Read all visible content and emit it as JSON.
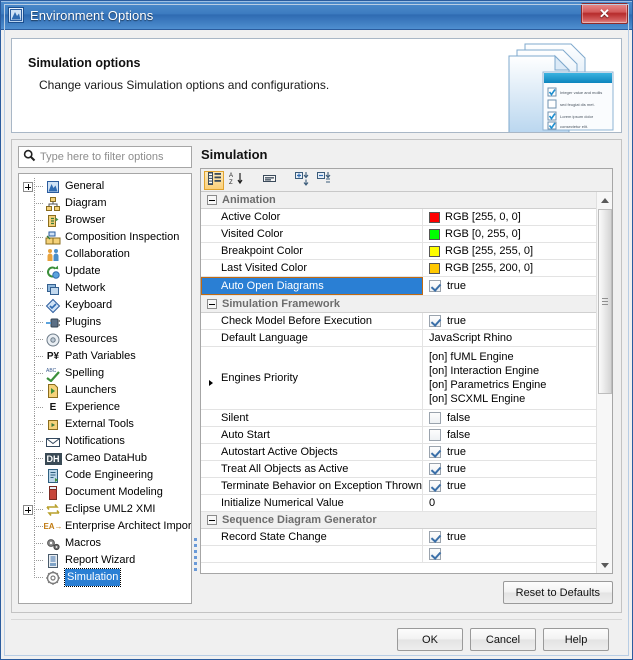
{
  "window": {
    "title": "Environment Options",
    "title_icon": "app-icon",
    "close_label": "✕"
  },
  "banner": {
    "title": "Simulation options",
    "subtitle": "Change various Simulation options and configurations.",
    "art_checkbox_lines": [
      "Integer value and mollis",
      "sed feugiat dis met.",
      "Lorem ipsum dolor",
      "consectetur elit."
    ]
  },
  "search": {
    "placeholder": "Type here to filter options",
    "value": "",
    "icon": "search-icon"
  },
  "tree": {
    "items": [
      {
        "label": "General",
        "icon": "general-icon",
        "expander": "plus",
        "selected": false
      },
      {
        "label": "Diagram",
        "icon": "diagram-icon",
        "expander": "none",
        "selected": false
      },
      {
        "label": "Browser",
        "icon": "browser-icon",
        "expander": "none",
        "selected": false
      },
      {
        "label": "Composition Inspection",
        "icon": "composition-inspection-icon",
        "expander": "none",
        "selected": false
      },
      {
        "label": "Collaboration",
        "icon": "collaboration-icon",
        "expander": "none",
        "selected": false
      },
      {
        "label": "Update",
        "icon": "update-icon",
        "expander": "none",
        "selected": false
      },
      {
        "label": "Network",
        "icon": "network-icon",
        "expander": "none",
        "selected": false
      },
      {
        "label": "Keyboard",
        "icon": "keyboard-icon",
        "expander": "none",
        "selected": false
      },
      {
        "label": "Plugins",
        "icon": "plugins-icon",
        "expander": "none",
        "selected": false
      },
      {
        "label": "Resources",
        "icon": "resources-icon",
        "expander": "none",
        "selected": false
      },
      {
        "label": "Path Variables",
        "icon": "path-variables-icon",
        "expander": "none",
        "selected": false
      },
      {
        "label": "Spelling",
        "icon": "spelling-icon",
        "expander": "none",
        "selected": false
      },
      {
        "label": "Launchers",
        "icon": "launchers-icon",
        "expander": "none",
        "selected": false
      },
      {
        "label": "Experience",
        "icon": "experience-icon",
        "expander": "none",
        "selected": false
      },
      {
        "label": "External Tools",
        "icon": "external-tools-icon",
        "expander": "none",
        "selected": false
      },
      {
        "label": "Notifications",
        "icon": "notifications-icon",
        "expander": "none",
        "selected": false
      },
      {
        "label": "Cameo DataHub",
        "icon": "cameo-datahub-icon",
        "expander": "none",
        "selected": false
      },
      {
        "label": "Code Engineering",
        "icon": "code-engineering-icon",
        "expander": "none",
        "selected": false
      },
      {
        "label": "Document Modeling",
        "icon": "document-modeling-icon",
        "expander": "none",
        "selected": false
      },
      {
        "label": "Eclipse UML2 XMI",
        "icon": "eclipse-uml2-xmi-icon",
        "expander": "plus",
        "selected": false
      },
      {
        "label": "Enterprise Architect Import",
        "icon": "enterprise-architect-import-icon",
        "expander": "none",
        "selected": false
      },
      {
        "label": "Macros",
        "icon": "macros-icon",
        "expander": "none",
        "selected": false
      },
      {
        "label": "Report Wizard",
        "icon": "report-wizard-icon",
        "expander": "none",
        "selected": false
      },
      {
        "label": "Simulation",
        "icon": "simulation-icon",
        "expander": "none",
        "selected": true
      }
    ]
  },
  "pane": {
    "title": "Simulation",
    "toolbar": [
      {
        "name": "categorized-view-button",
        "icon": "categorized-list-icon",
        "active": true
      },
      {
        "name": "sort-alphabetically-button",
        "icon": "sort-az-icon",
        "active": false
      },
      {
        "name": "show-description-button",
        "icon": "description-panel-icon",
        "active": false
      },
      {
        "name": "expand-all-button",
        "icon": "expand-all-icon",
        "active": false
      },
      {
        "name": "collapse-all-button",
        "icon": "collapse-all-icon",
        "active": false
      }
    ],
    "reset_label": "Reset to Defaults"
  },
  "grid": {
    "rows": [
      {
        "type": "category",
        "label": "Animation"
      },
      {
        "type": "color",
        "name": "Active Color",
        "value": "RGB [255, 0, 0]",
        "swatch": "#FF0000"
      },
      {
        "type": "color",
        "name": "Visited Color",
        "value": "RGB [0, 255, 0]",
        "swatch": "#00FF00"
      },
      {
        "type": "color",
        "name": "Breakpoint Color",
        "value": "RGB [255, 255, 0]",
        "swatch": "#FFFF00"
      },
      {
        "type": "color",
        "name": "Last Visited Color",
        "value": "RGB [255, 200, 0]",
        "swatch": "#FFC800"
      },
      {
        "type": "bool",
        "name": "Auto Open Diagrams",
        "value": "true",
        "checked": true,
        "selected": true
      },
      {
        "type": "category",
        "label": "Simulation Framework"
      },
      {
        "type": "bool",
        "name": "Check Model Before Execution",
        "value": "true",
        "checked": true
      },
      {
        "type": "text",
        "name": "Default Language",
        "value": "JavaScript Rhino"
      },
      {
        "type": "multi",
        "name": "Engines Priority",
        "values": [
          "[on] fUML Engine",
          "[on] Interaction Engine",
          "[on] Parametrics Engine",
          "[on] SCXML Engine"
        ]
      },
      {
        "type": "bool",
        "name": "Silent",
        "value": "false",
        "checked": false
      },
      {
        "type": "bool",
        "name": "Auto Start",
        "value": "false",
        "checked": false
      },
      {
        "type": "bool",
        "name": "Autostart Active Objects",
        "value": "true",
        "checked": true
      },
      {
        "type": "bool",
        "name": "Treat All Objects as Active",
        "value": "true",
        "checked": true
      },
      {
        "type": "bool",
        "name": "Terminate Behavior on Exception Thrown",
        "value": "true",
        "checked": true
      },
      {
        "type": "text",
        "name": "Initialize Numerical Value",
        "value": "0"
      },
      {
        "type": "category",
        "label": "Sequence Diagram Generator"
      },
      {
        "type": "bool",
        "name": "Record State Change",
        "value": "true",
        "checked": true
      },
      {
        "type": "partial",
        "name": "",
        "value": "",
        "checked": true
      }
    ]
  },
  "footer": {
    "ok_label": "OK",
    "cancel_label": "Cancel",
    "help_label": "Help"
  }
}
